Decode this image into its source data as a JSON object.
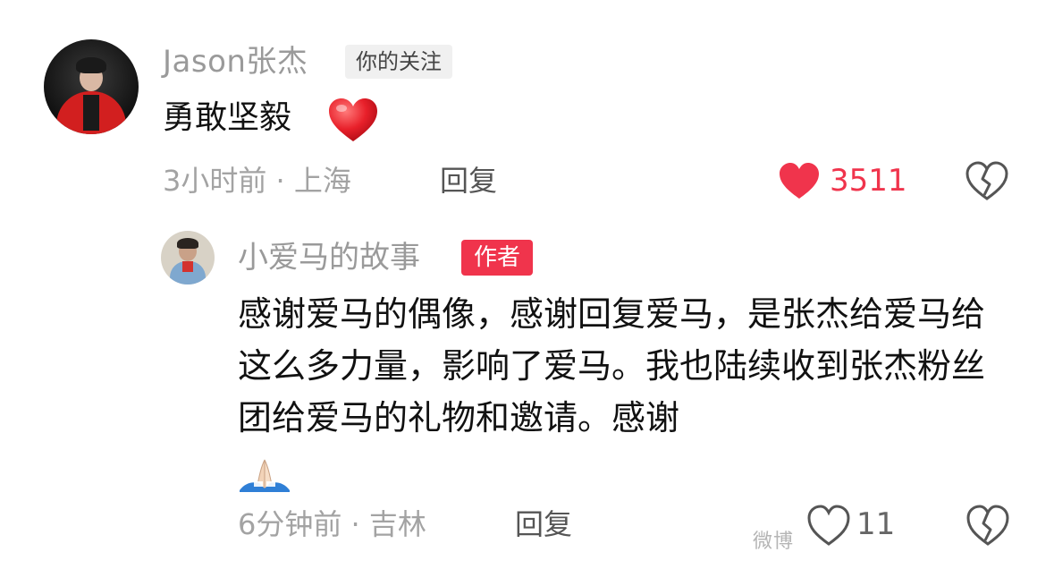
{
  "main_comment": {
    "author": "Jason张杰",
    "badge": "你的关注",
    "text": "勇敢坚毅",
    "emoji": "red-heart-emoji",
    "meta": "3小时前 · 上海",
    "reply_label": "回复",
    "likes": "3511",
    "like_color": "#f0344c"
  },
  "reply_comment": {
    "author": "小爱马的故事",
    "badge": "作者",
    "badge_color": "#f0344c",
    "text": "感谢爱马的偶像，感谢回复爱马，是张杰给爱马给这么多力量，影响了爱马。我也陆续收到张杰粉丝团给爱马的礼物和邀请。感谢",
    "emoji": "folded-hands-emoji",
    "meta": "6分钟前 · 吉林",
    "reply_label": "回复",
    "likes": "11"
  },
  "watermark": "微博"
}
